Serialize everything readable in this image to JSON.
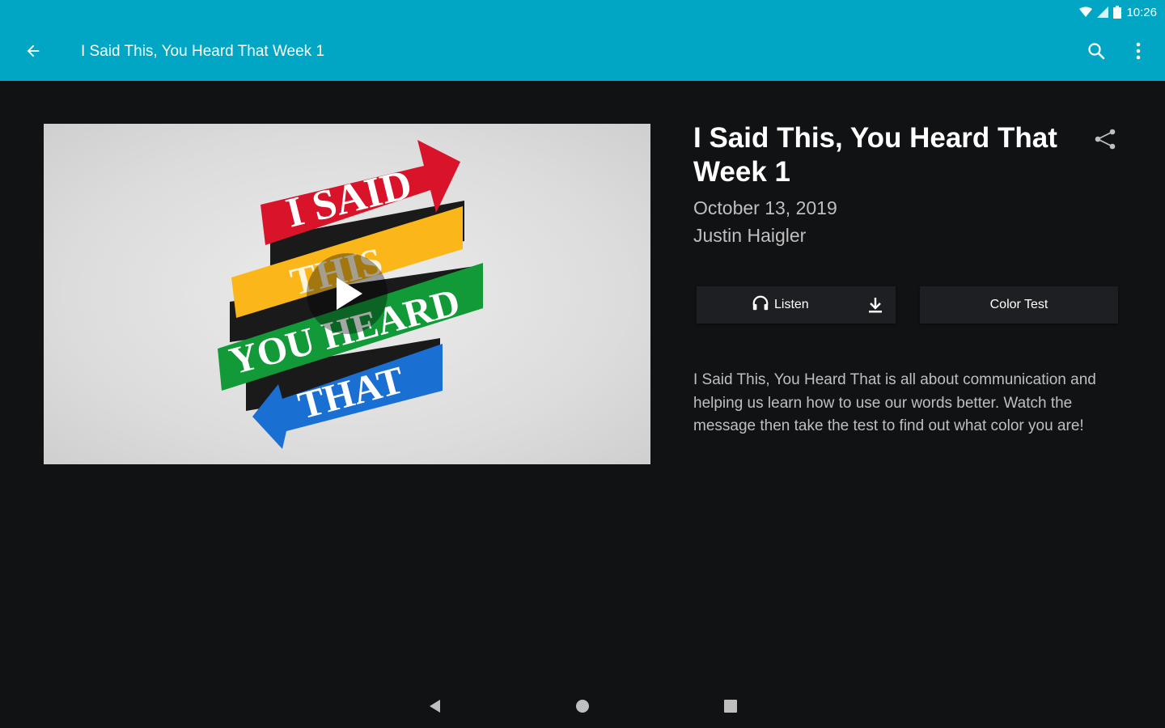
{
  "status_bar": {
    "time": "10:26"
  },
  "app_bar": {
    "title": "I Said This, You Heard That Week 1"
  },
  "hero": {
    "lines": [
      "I SAID",
      "THIS",
      "YOU HEARD",
      "THAT"
    ],
    "colors": [
      "#d9142a",
      "#fbb71a",
      "#119a37",
      "#1a6fd2"
    ]
  },
  "detail": {
    "title": "I Said This, You Heard That Week 1",
    "date": "October 13, 2019",
    "author": "Justin Haigler",
    "listen_label": "Listen",
    "color_test_label": "Color Test",
    "description": "I Said This, You Heard That is all about communication and helping us learn how to use our words better. Watch the message then take the test to find out what color you are!"
  },
  "icons": {
    "back": "arrow-back-icon",
    "search": "search-icon",
    "menu": "more-vert-icon",
    "share": "share-icon",
    "headphones": "headphones-icon",
    "download": "download-icon",
    "play": "play-icon"
  },
  "theme": {
    "accent": "#00a6c4",
    "background": "#111214",
    "button": "#1e1f22"
  }
}
